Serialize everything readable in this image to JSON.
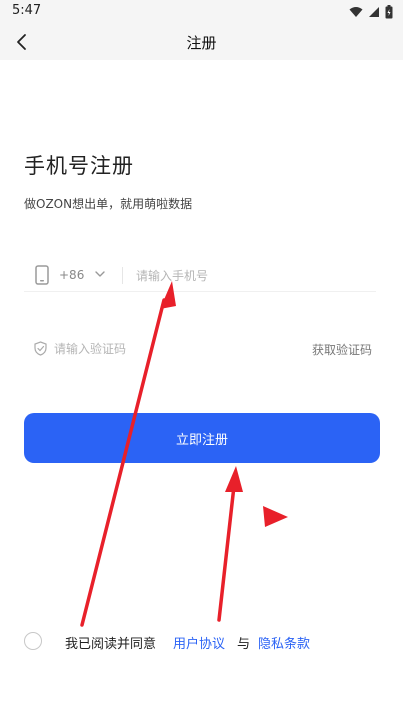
{
  "status_bar": {
    "time": "5:47"
  },
  "app_bar": {
    "title": "注册"
  },
  "page": {
    "heading": "手机号注册",
    "subtitle": "做OZON想出单，就用萌啦数据"
  },
  "phone_field": {
    "country_code": "+86",
    "placeholder": "请输入手机号",
    "value": ""
  },
  "code_field": {
    "placeholder": "请输入验证码",
    "value": "",
    "get_code_label": "获取验证码"
  },
  "register_button": {
    "label": "立即注册"
  },
  "agreement": {
    "checked": false,
    "prefix": "我已阅读并同意",
    "user_agreement": "用户协议",
    "conjunction": "与",
    "privacy_policy": "隐私条款"
  },
  "icons": {
    "status": [
      "wifi-icon",
      "signal-icon",
      "battery-icon"
    ],
    "back": "chevron-left-icon",
    "phone": "smartphone-icon",
    "dropdown": "chevron-down-icon",
    "verify": "shield-check-icon",
    "annotations": "red-arrow-icon"
  },
  "colors": {
    "primary": "#2b63f5",
    "annotation": "#e8202a",
    "header_bg": "#f5f5f5"
  }
}
